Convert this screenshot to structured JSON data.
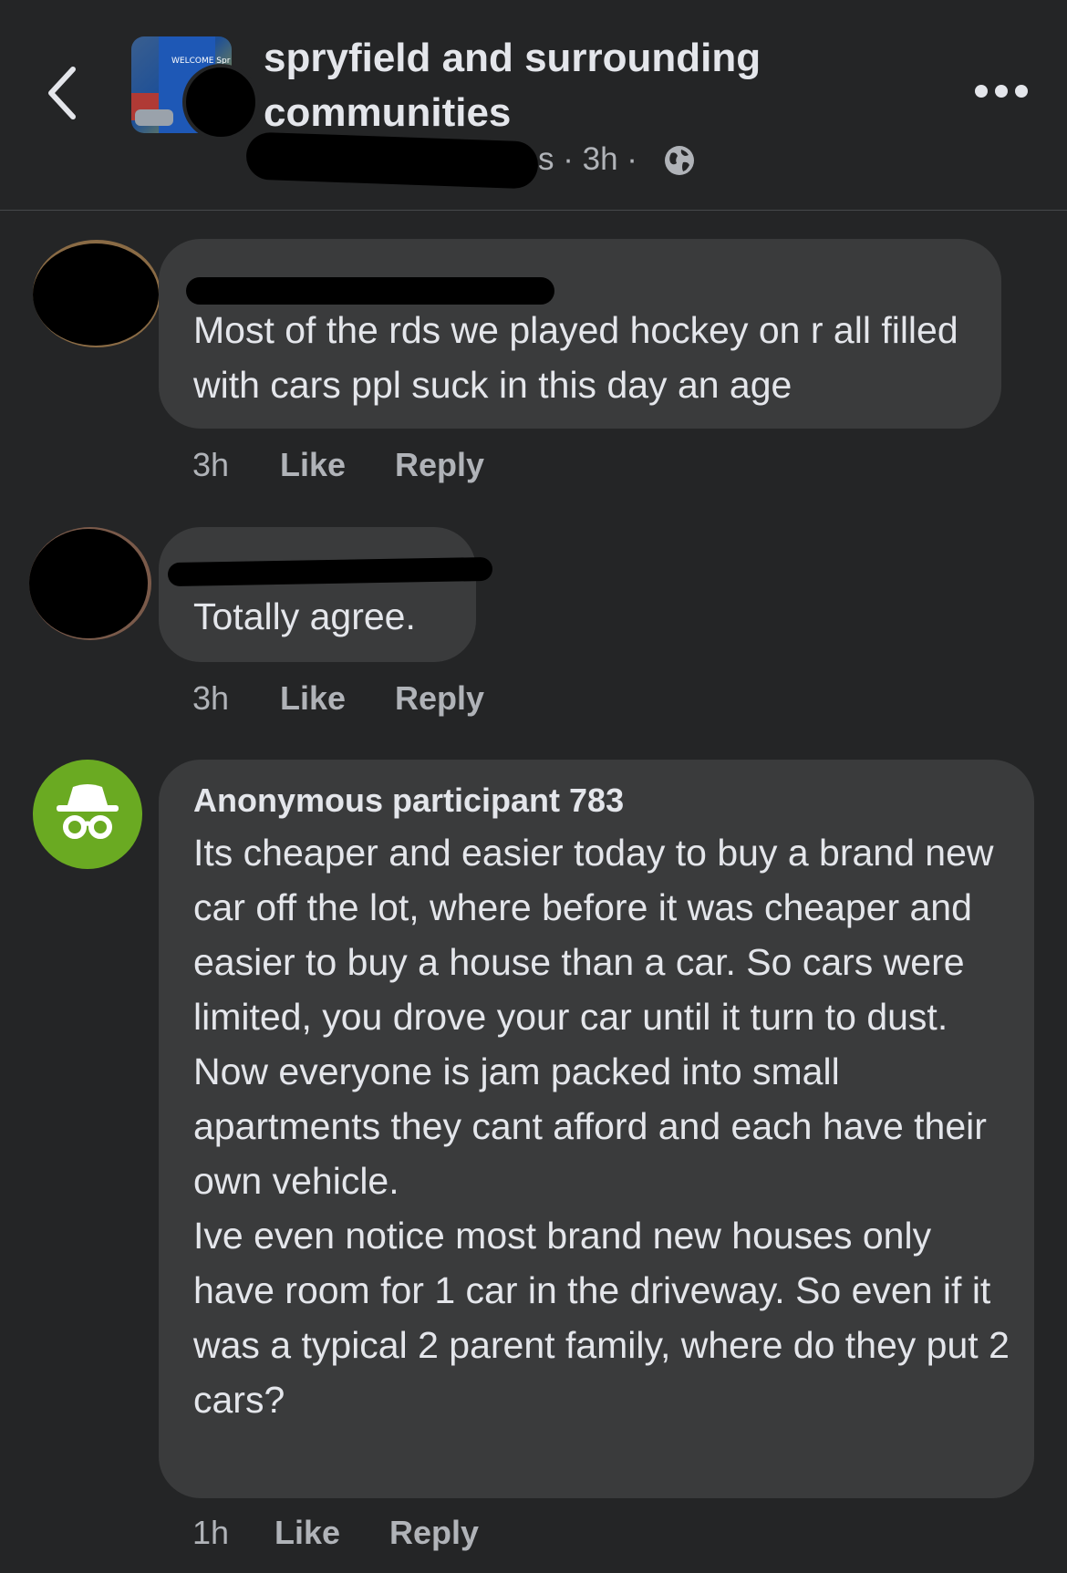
{
  "header": {
    "back_icon": "chevron-left-icon",
    "group_name": "spryfield and surrounding communities",
    "thumbnail_sign_text": "WELCOME Spr",
    "meta_partial": "s · 3h ·",
    "globe_icon": "globe-icon",
    "more_icon": "ellipsis-icon"
  },
  "comments": [
    {
      "text": "Most of the rds we played hockey on r all filled with cars ppl suck in this day an age",
      "time": "3h",
      "like_label": "Like",
      "reply_label": "Reply"
    },
    {
      "text": "Totally agree.",
      "time": "3h",
      "like_label": "Like",
      "reply_label": "Reply"
    },
    {
      "author": "Anonymous participant 783",
      "avatar_icon": "incognito-icon",
      "avatar_color": "#6aaa22",
      "text": "Its cheaper and easier today to buy a brand new car off the lot, where before it was cheaper and easier to buy a house than a car. So cars were limited, you drove your car until it turn to dust. Now everyone is jam packed into small apartments they cant afford and each have their own vehicle.\nIve even notice most brand new houses only have room for 1 car in the driveway. So even if it was a typical 2 parent family, where do they put 2 cars?",
      "time": "1h",
      "like_label": "Like",
      "reply_label": "Reply"
    }
  ]
}
